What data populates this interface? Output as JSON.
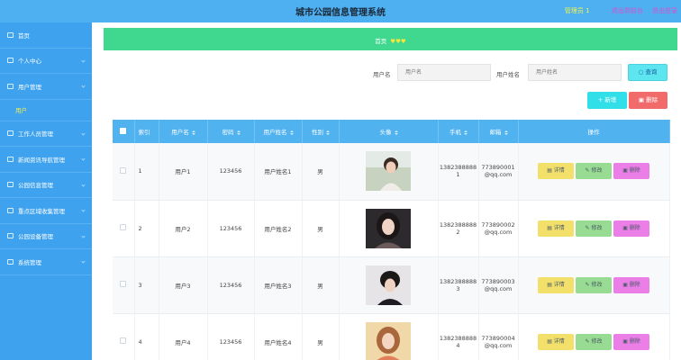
{
  "header": {
    "title": "城市公园信息管理系统",
    "admin": "管理员 1",
    "home_link": "退出到前台",
    "logout_link": "退出登录"
  },
  "sidebar": {
    "items": [
      {
        "label": "首页"
      },
      {
        "label": "个人中心"
      },
      {
        "label": "用户管理"
      },
      {
        "label": "用户"
      },
      {
        "label": "工作人员管理"
      },
      {
        "label": "新闻资讯导航管理"
      },
      {
        "label": "公园信息管理"
      },
      {
        "label": "重点区域收集管理"
      },
      {
        "label": "公园设备管理"
      },
      {
        "label": "系统管理"
      }
    ]
  },
  "breadcrumb": {
    "label": "首页",
    "hearts": "♥♥♥"
  },
  "search": {
    "username_label": "用户名",
    "username_placeholder": "用户名",
    "realname_label": "用户姓名",
    "realname_placeholder": "用户姓名",
    "query_button": "查询"
  },
  "toolbar": {
    "add_label": "新增",
    "delete_label": "删除"
  },
  "table": {
    "columns": [
      "索引",
      "用户名",
      "密码",
      "用户姓名",
      "性别",
      "头像",
      "手机",
      "邮箱",
      "操作"
    ],
    "rows": [
      {
        "index": "1",
        "username": "用户1",
        "password": "123456",
        "realname": "用户姓名1",
        "gender": "男",
        "phone": [
          "1382388888",
          "1"
        ],
        "email": [
          "773890001",
          "@qq.com"
        ]
      },
      {
        "index": "2",
        "username": "用户2",
        "password": "123456",
        "realname": "用户姓名2",
        "gender": "男",
        "phone": [
          "1382388888",
          "2"
        ],
        "email": [
          "773890002",
          "@qq.com"
        ]
      },
      {
        "index": "3",
        "username": "用户3",
        "password": "123456",
        "realname": "用户姓名3",
        "gender": "男",
        "phone": [
          "1382388888",
          "3"
        ],
        "email": [
          "773890003",
          "@qq.com"
        ]
      },
      {
        "index": "4",
        "username": "用户4",
        "password": "123456",
        "realname": "用户姓名4",
        "gender": "男",
        "phone": [
          "1382388888",
          "4"
        ],
        "email": [
          "773890004",
          "@qq.com"
        ]
      }
    ],
    "actions": {
      "detail": "详情",
      "edit": "修改",
      "delete": "删除"
    }
  },
  "colors": {
    "header": "#4eb0f0",
    "sidebar": "#3ea2ee",
    "breadcrumb": "#3fd88e",
    "table_header": "#51b2f0"
  }
}
